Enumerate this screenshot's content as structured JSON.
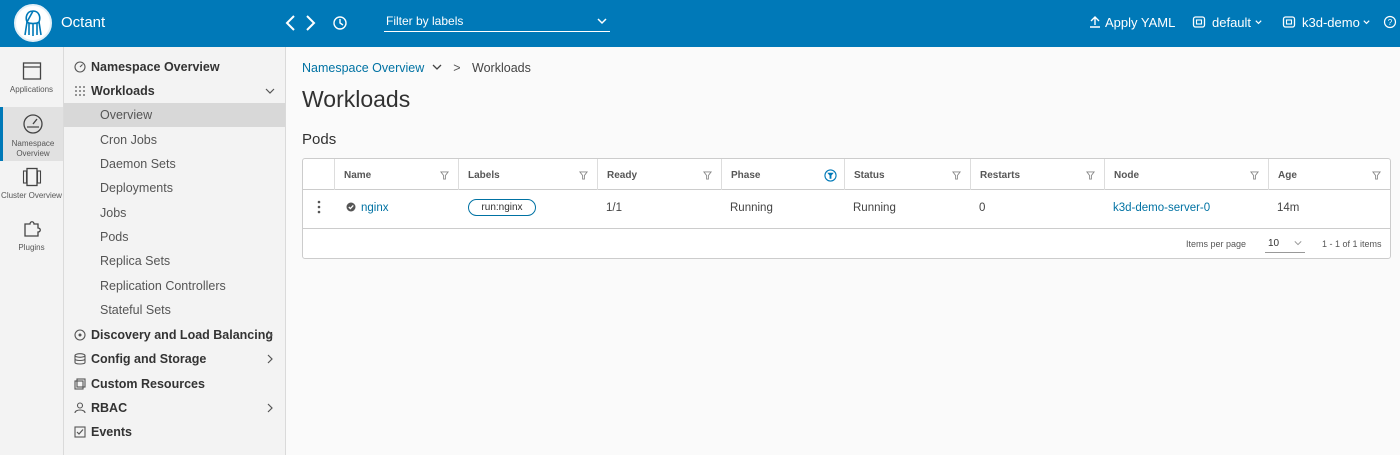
{
  "header": {
    "app_title": "Octant",
    "filter_placeholder": "Filter by labels",
    "apply_yaml": "Apply YAML",
    "namespace": "default",
    "cluster": "k3d-demo"
  },
  "iconnav": [
    {
      "label": "Applications",
      "icon": "window-icon"
    },
    {
      "label": "Namespace Overview",
      "icon": "dashboard-icon"
    },
    {
      "label": "Cluster Overview",
      "icon": "cluster-icon"
    },
    {
      "label": "Plugins",
      "icon": "puzzle-icon"
    }
  ],
  "sidenav": {
    "namespace_overview": "Namespace Overview",
    "workloads": "Workloads",
    "overview": "Overview",
    "cron_jobs": "Cron Jobs",
    "daemon_sets": "Daemon Sets",
    "deployments": "Deployments",
    "jobs": "Jobs",
    "pods": "Pods",
    "replica_sets": "Replica Sets",
    "replication_controllers": "Replication Controllers",
    "stateful_sets": "Stateful Sets",
    "discovery": "Discovery and Load Balancing",
    "config": "Config and Storage",
    "custom_resources": "Custom Resources",
    "rbac": "RBAC",
    "events": "Events"
  },
  "breadcrumb": {
    "parent": "Namespace Overview",
    "current": "Workloads"
  },
  "page_title": "Workloads",
  "section_title": "Pods",
  "table": {
    "columns": [
      "Name",
      "Labels",
      "Ready",
      "Phase",
      "Status",
      "Restarts",
      "Node",
      "Age"
    ],
    "rows": [
      {
        "name": "nginx",
        "label": "run:nginx",
        "ready": "1/1",
        "phase": "Running",
        "status": "Running",
        "restarts": "0",
        "node": "k3d-demo-server-0",
        "age": "14m"
      }
    ],
    "items_per_page_label": "Items per page",
    "items_per_page": "10",
    "pagination": "1 - 1 of 1 items"
  },
  "colors": {
    "accent": "#0079b8",
    "link": "#0072a3",
    "success": "#555555"
  }
}
